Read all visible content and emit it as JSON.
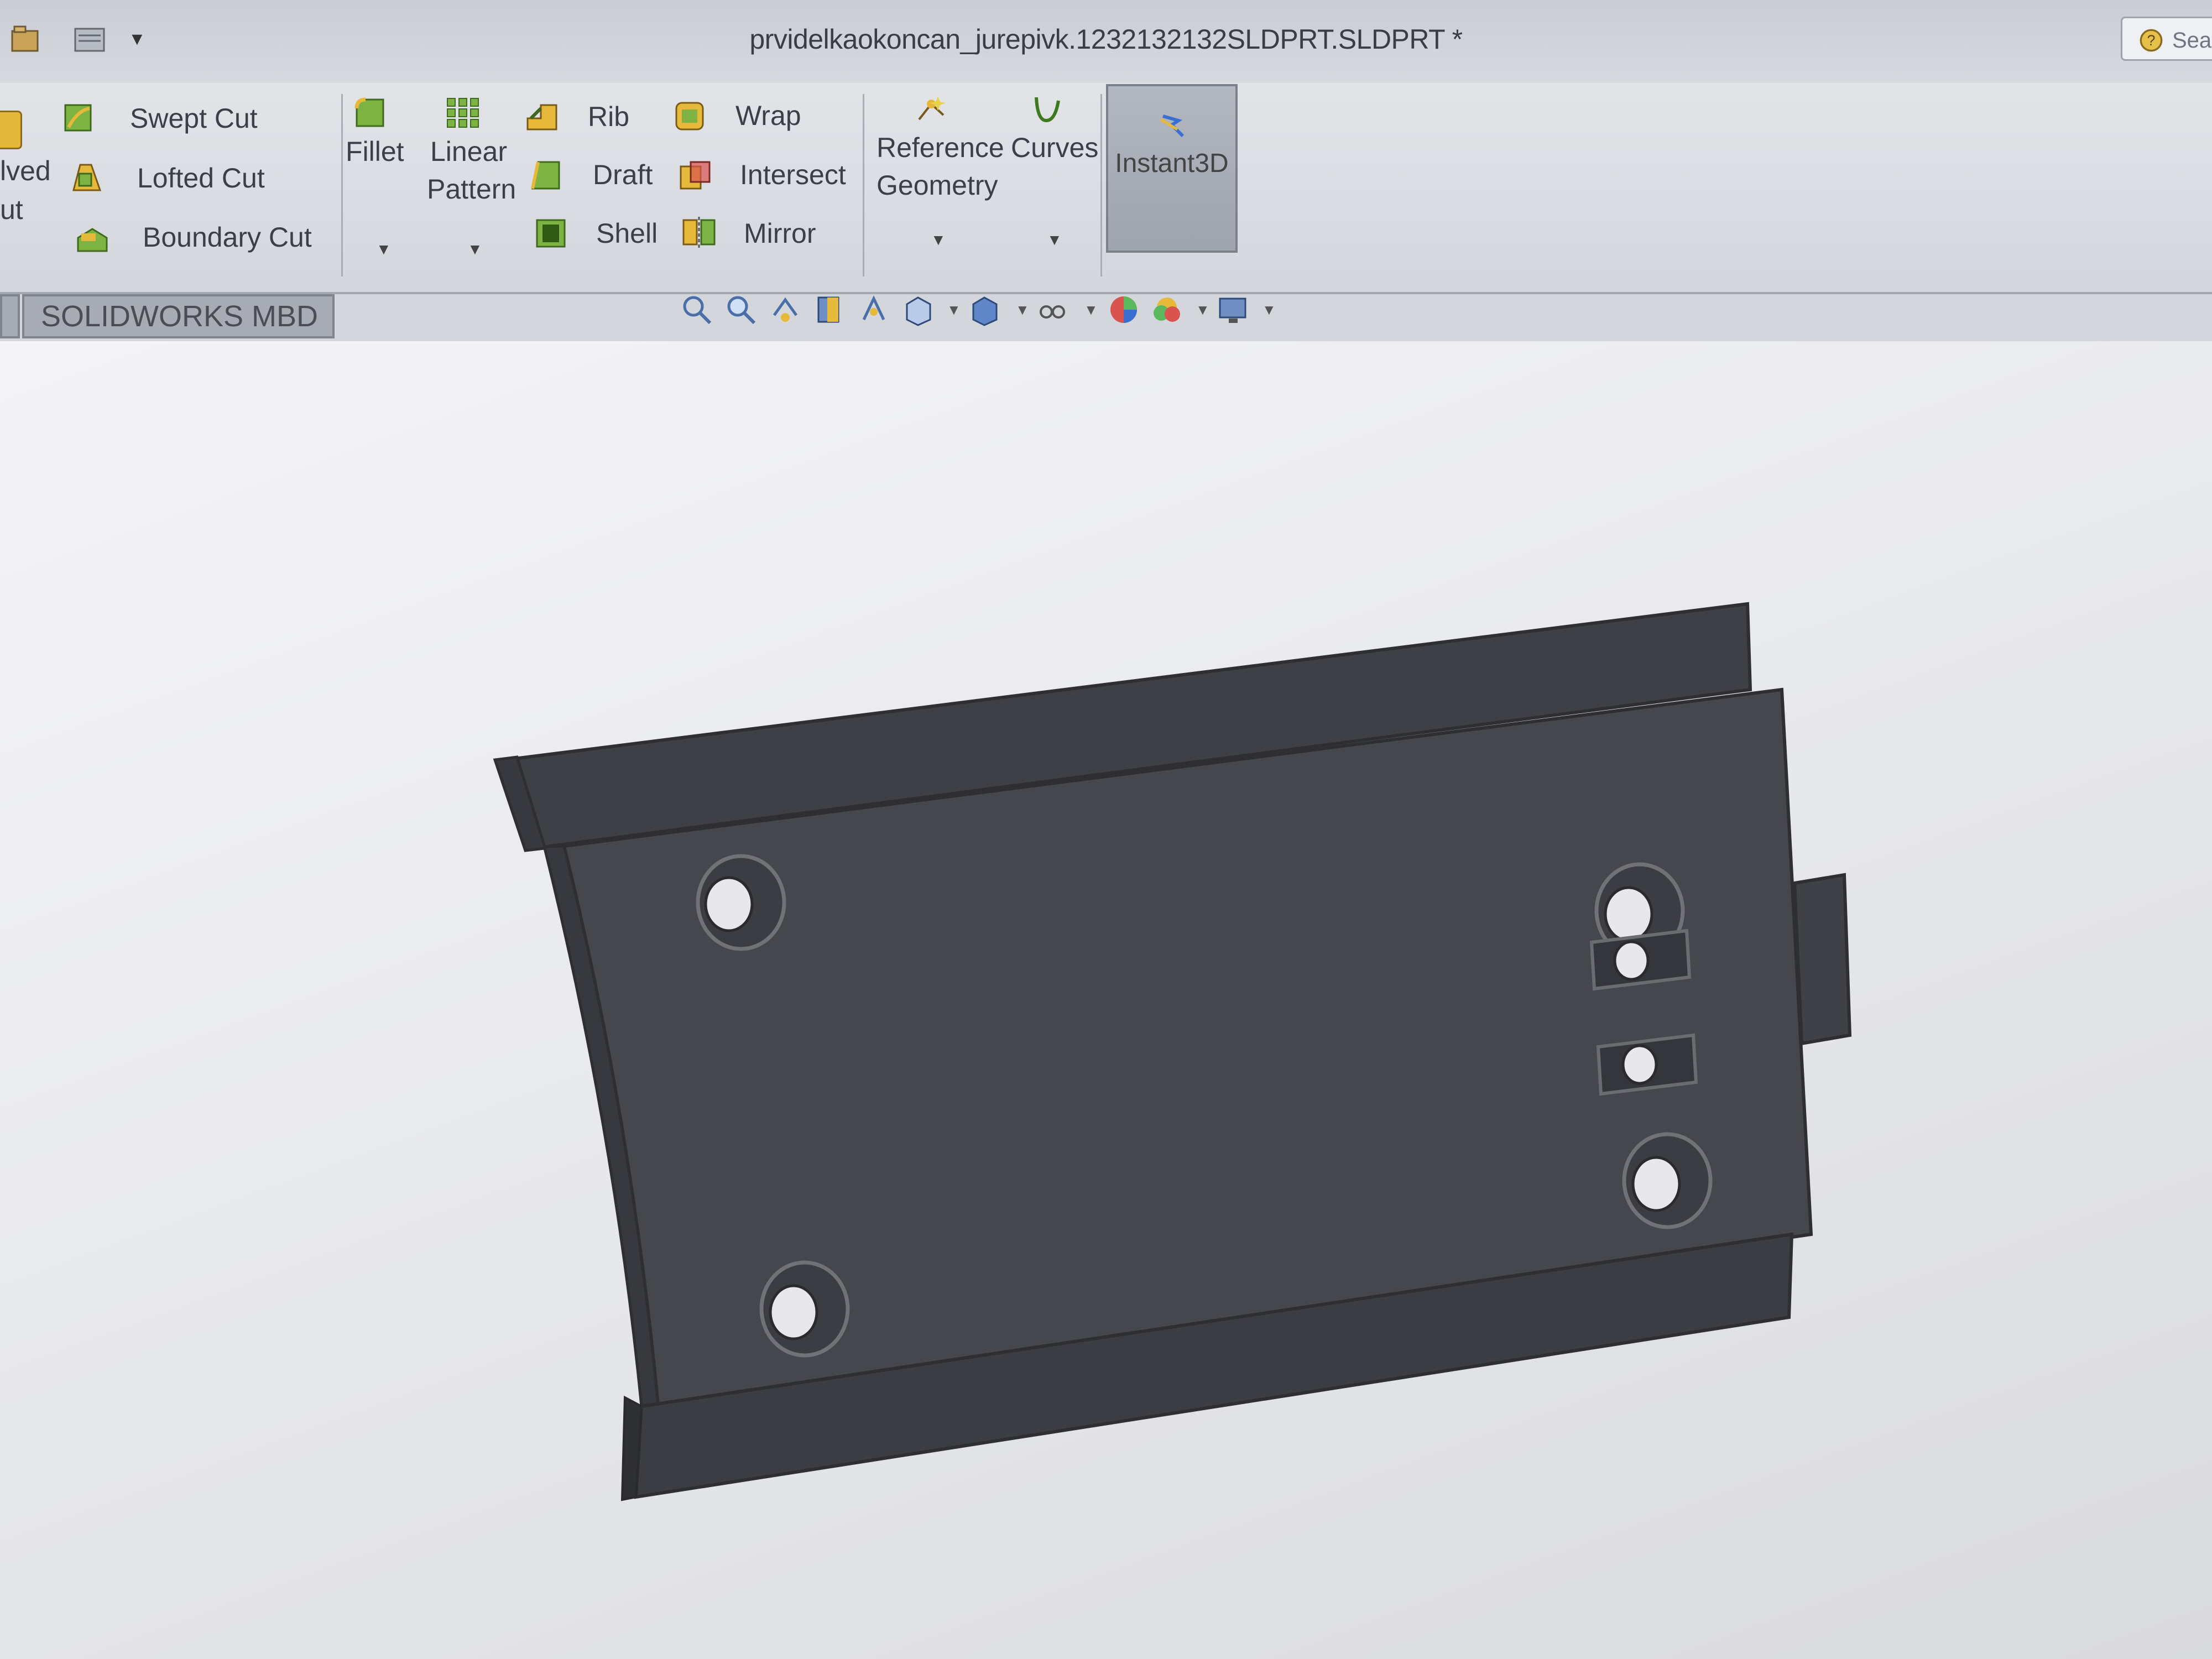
{
  "window": {
    "title": "prvidelkaokoncan_jurepivk.1232132132SLDPRT.SLDPRT *",
    "search_text": "Sea"
  },
  "ribbon": {
    "revolved_cut_label_line1": "lved",
    "revolved_cut_label_line2": "ut",
    "swept_cut": "Swept Cut",
    "lofted_cut": "Lofted Cut",
    "boundary_cut": "Boundary Cut",
    "fillet": "Fillet",
    "linear_pattern_line1": "Linear",
    "linear_pattern_line2": "Pattern",
    "rib": "Rib",
    "draft": "Draft",
    "shell": "Shell",
    "wrap": "Wrap",
    "intersect": "Intersect",
    "mirror": "Mirror",
    "reference_geometry_line1": "Reference",
    "reference_geometry_line2": "Geometry",
    "curves": "Curves",
    "instant3d": "Instant3D"
  },
  "tabs": {
    "mbd": "SOLIDWORKS MBD"
  },
  "icons": {
    "swept_cut": "swept-cut-icon",
    "lofted_cut": "lofted-cut-icon",
    "boundary_cut": "boundary-cut-icon",
    "fillet": "fillet-icon",
    "linear_pattern": "linear-pattern-icon",
    "rib": "rib-icon",
    "draft": "draft-icon",
    "shell": "shell-icon",
    "wrap": "wrap-icon",
    "intersect": "intersect-icon",
    "mirror": "mirror-icon",
    "reference_geometry": "reference-geometry-icon",
    "curves": "curves-icon",
    "instant3d": "instant3d-icon"
  },
  "colors": {
    "part_face": "#46474c",
    "part_edge": "#2e2f33",
    "accent_green": "#7cb342",
    "accent_yellow": "#e7b93a"
  }
}
